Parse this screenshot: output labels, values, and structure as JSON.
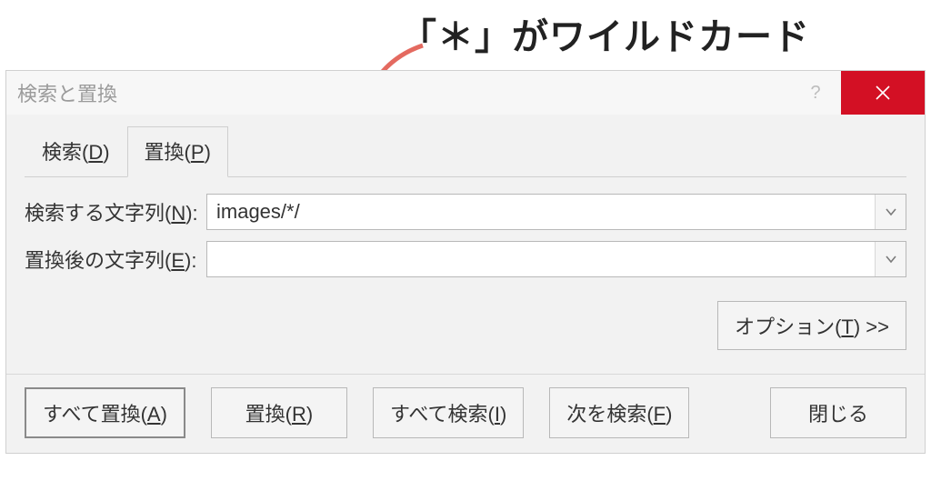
{
  "annotation": {
    "text": "「＊」がワイルドカード"
  },
  "dialog": {
    "title": "検索と置換",
    "tabs": {
      "search": {
        "label": "検索(D)",
        "underline_char": "D"
      },
      "replace": {
        "label": "置換(P)",
        "underline_char": "P"
      }
    },
    "fields": {
      "find": {
        "label": "検索する文字列(N):",
        "underline_char": "N",
        "value": "images/*/"
      },
      "replace": {
        "label": "置換後の文字列(E):",
        "underline_char": "E",
        "value": ""
      }
    },
    "options_button": {
      "label": "オプション(T) >>",
      "underline_char": "T"
    },
    "actions": {
      "replace_all": {
        "label": "すべて置換(A)",
        "underline_char": "A"
      },
      "replace_one": {
        "label": "置換(R)",
        "underline_char": "R"
      },
      "find_all": {
        "label": "すべて検索(I)",
        "underline_char": "I"
      },
      "find_next": {
        "label": "次を検索(F)",
        "underline_char": "F"
      },
      "close": {
        "label": "閉じる"
      }
    },
    "help_button": {
      "hint": "?"
    },
    "close_button": {
      "hint": "×"
    }
  },
  "colors": {
    "accent_close": "#d31024",
    "annotation_arrow": "#e46a60"
  }
}
